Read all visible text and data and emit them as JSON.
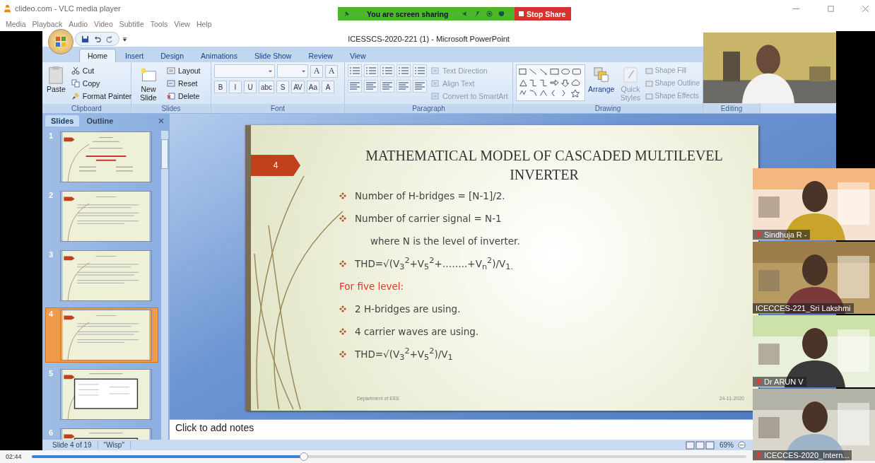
{
  "vlc": {
    "title": "clideo.com - VLC media player",
    "menu": [
      "Media",
      "Playback",
      "Audio",
      "Video",
      "Subtitle",
      "Tools",
      "View",
      "Help"
    ],
    "time": "02:44",
    "progress": {
      "level": 0.38
    }
  },
  "share_bar": {
    "message": "You are screen sharing",
    "stop": "Stop Share"
  },
  "ppt": {
    "title": "ICESSCS-2020-221 (1) - Microsoft PowerPoint",
    "tabs": [
      {
        "label": "Home",
        "selected": true
      },
      {
        "label": "Insert",
        "selected": false
      },
      {
        "label": "Design",
        "selected": false
      },
      {
        "label": "Animations",
        "selected": false
      },
      {
        "label": "Slide Show",
        "selected": false
      },
      {
        "label": "Review",
        "selected": false
      },
      {
        "label": "View",
        "selected": false
      }
    ],
    "ribbon": {
      "clipboard": {
        "label": "Clipboard",
        "paste": "Paste",
        "items": [
          {
            "label": "Cut",
            "kind": "cut"
          },
          {
            "label": "Copy",
            "kind": "copy"
          },
          {
            "label": "Format Painter",
            "kind": "painter"
          }
        ]
      },
      "slides": {
        "label": "Slides",
        "new_slide": "New Slide",
        "items": [
          {
            "label": "Layout",
            "kind": "layout"
          },
          {
            "label": "Reset",
            "kind": "reset"
          },
          {
            "label": "Delete",
            "kind": "delete"
          }
        ]
      },
      "font": {
        "label": "Font",
        "row1": [
          "A",
          "A"
        ],
        "row2": [
          "B",
          "I",
          "U",
          "abc",
          "S",
          "AV",
          "Aa",
          "A"
        ]
      },
      "paragraph": {
        "label": "Paragraph",
        "items": [
          {
            "label": "Text Direction",
            "disabled": true
          },
          {
            "label": "Align Text",
            "disabled": true
          },
          {
            "label": "Convert to SmartArt",
            "disabled": true
          }
        ]
      },
      "drawing": {
        "label": "Drawing",
        "arrange": "Arrange",
        "quick_styles": {
          "label": "Quick Styles",
          "disabled": true
        },
        "items": [
          {
            "label": "Shape Fill",
            "disabled": true
          },
          {
            "label": "Shape Outline",
            "disabled": true
          },
          {
            "label": "Shape Effects",
            "disabled": true
          }
        ]
      },
      "editing": {
        "label": "Editing"
      }
    },
    "pane_tabs": [
      {
        "label": "Slides",
        "selected": true
      },
      {
        "label": "Outline",
        "selected": false
      }
    ],
    "thumbnails": [
      {
        "number": "1",
        "selected": false,
        "kind": "title"
      },
      {
        "number": "2",
        "selected": false,
        "kind": "text"
      },
      {
        "number": "3",
        "selected": false,
        "kind": "text"
      },
      {
        "number": "4",
        "selected": true,
        "kind": "text"
      },
      {
        "number": "5",
        "selected": false,
        "kind": "table"
      },
      {
        "number": "6",
        "selected": false,
        "kind": "table"
      }
    ],
    "slide": {
      "number": "4",
      "title": "MATHEMATICAL MODEL OF CASCADED MULTILEVEL INVERTER",
      "lines": [
        {
          "kind": "bullet",
          "text": "Number of H-bridges = [N-1]/2."
        },
        {
          "kind": "bullet",
          "text": "Number of carrier signal = N-1"
        },
        {
          "kind": "indent",
          "text": "where N is the level of inverter."
        },
        {
          "kind": "bullet",
          "text": "THD=√(V$_{3}$$^{2}$+V$_{5}$$^{2}$+……..+V$_{n}$$^{2}$)/V$_{1.}$"
        },
        {
          "kind": "heading",
          "text": "For five level:"
        },
        {
          "kind": "bullet",
          "text": "2 H-bridges are using."
        },
        {
          "kind": "bullet",
          "text": " 4 carrier waves are using."
        },
        {
          "kind": "bullet",
          "text": "THD=√(V$_{3}$$^{2}$+V$_{5}$$^{2}$)/V$_{1}$"
        }
      ],
      "footer": "Department of EEE",
      "date": "24-11-2020"
    },
    "notes_placeholder": "Click to add notes",
    "status": {
      "slide": "Slide 4 of 19",
      "theme": "\"Wisp\"",
      "zoom": "69%"
    }
  },
  "participants": [
    {
      "name": "Sindhuja R -",
      "muted": true
    },
    {
      "name": "ICECCES-221_Sri Lakshmi",
      "muted": false
    },
    {
      "name": "Dr ARUN V",
      "muted": true
    },
    {
      "name": "ICECCES-2020_Intern...",
      "muted": true
    }
  ]
}
